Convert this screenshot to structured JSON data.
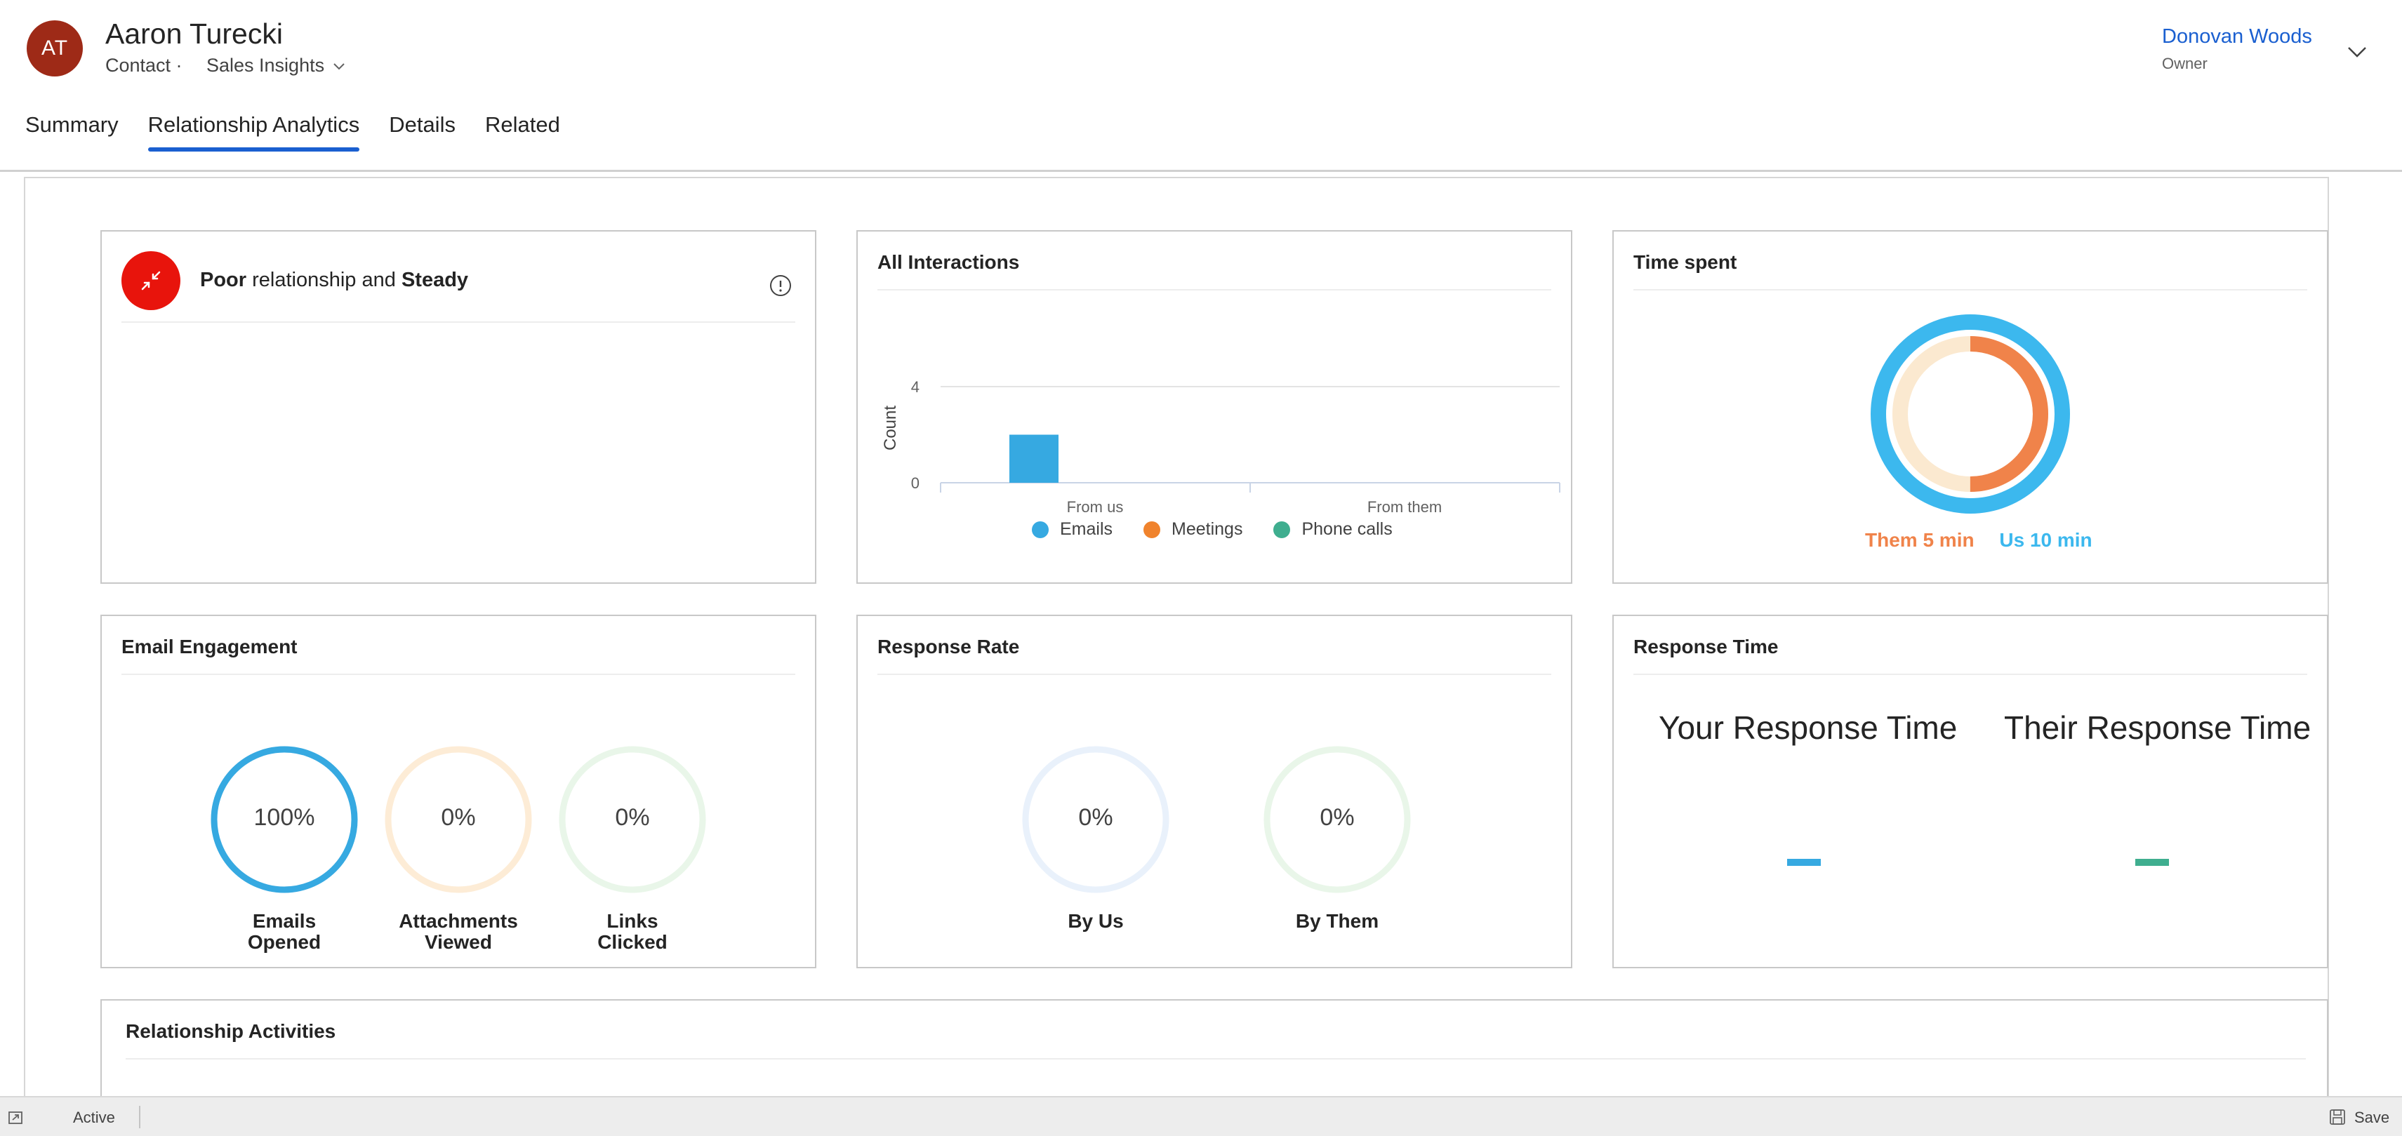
{
  "record": {
    "initials": "AT",
    "name": "Aaron Turecki",
    "type": "Contact ·",
    "form": "Sales Insights",
    "owner_name": "Donovan Woods",
    "owner_label": "Owner"
  },
  "tabs": [
    {
      "label": "Summary",
      "active": false
    },
    {
      "label": "Relationship Analytics",
      "active": true
    },
    {
      "label": "Details",
      "active": false
    },
    {
      "label": "Related",
      "active": false
    }
  ],
  "relationship": {
    "health": "Poor",
    "middle": " relationship and ",
    "trend": "Steady"
  },
  "interactions": {
    "title": "All Interactions",
    "ylabel": "Count",
    "ticks": [
      "4",
      "0"
    ],
    "categories": [
      "From us",
      "From them"
    ],
    "values": [
      2,
      0
    ],
    "ymax": 4,
    "legend": [
      {
        "label": "Emails",
        "color": "#36a9e1"
      },
      {
        "label": "Meetings",
        "color": "#f0832d"
      },
      {
        "label": "Phone calls",
        "color": "#3fae8f"
      }
    ]
  },
  "time_spent": {
    "title": "Time spent",
    "them_label": "Them 5 min",
    "us_label": "Us 10 min",
    "them_minutes": 5,
    "us_minutes": 10,
    "colors": {
      "them": "#f0834a",
      "us": "#3cb8ee",
      "track": "#fbe9d0"
    }
  },
  "email_engagement": {
    "title": "Email Engagement",
    "metrics": [
      {
        "value": "100%",
        "label_line1": "Emails",
        "label_line2": "Opened",
        "percent": 100,
        "color": "#36a9e1",
        "track": "#e6f3fb"
      },
      {
        "value": "0%",
        "label_line1": "Attachments",
        "label_line2": "Viewed",
        "percent": 0,
        "color": "#f0a030",
        "track": "#fdecd6"
      },
      {
        "value": "0%",
        "label_line1": "Links",
        "label_line2": "Clicked",
        "percent": 0,
        "color": "#3fae6f",
        "track": "#e9f6e9"
      }
    ]
  },
  "response_rate": {
    "title": "Response Rate",
    "metrics": [
      {
        "value": "0%",
        "label": "By Us",
        "percent": 0,
        "track": "#e9f1fb"
      },
      {
        "value": "0%",
        "label": "By Them",
        "percent": 0,
        "track": "#e9f6e9"
      }
    ]
  },
  "response_time": {
    "title": "Response Time",
    "yours": "Your Response Time",
    "theirs": "Their Response Time",
    "yours_value": "–",
    "theirs_value": "–",
    "colors": {
      "yours": "#36a9e1",
      "theirs": "#3fae8f"
    }
  },
  "activities": {
    "title": "Relationship Activities"
  },
  "status": {
    "state": "Active",
    "save_label": "Save"
  }
}
